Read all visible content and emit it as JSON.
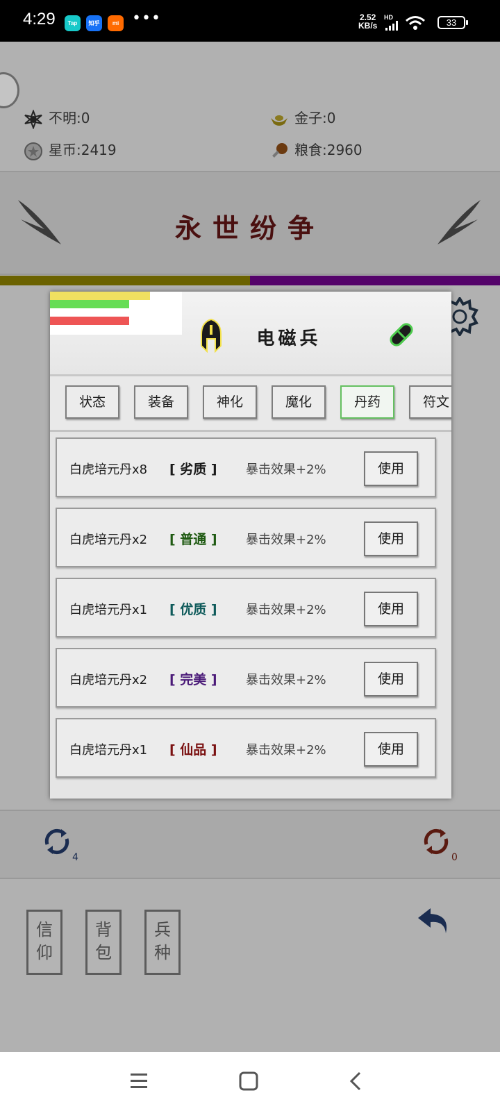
{
  "status_bar": {
    "time": "4:29",
    "apps": [
      {
        "name": "Tap",
        "color": "#18c9c9"
      },
      {
        "name": "知乎",
        "color": "#1772f6"
      },
      {
        "name": "mi",
        "color": "#ff6a00"
      }
    ],
    "more": "•••",
    "net_speed_value": "2.52",
    "net_speed_unit": "KB/s",
    "hd_label": "HD",
    "battery": "33"
  },
  "resources": {
    "unknown": "不明:0",
    "gold": "金子:0",
    "star_coins": "星币:2419",
    "food": "粮食:2960"
  },
  "game": {
    "title": "永世纷争",
    "player_bar_fraction": 0.5,
    "left_refresh_count": "4",
    "right_refresh_count": "0",
    "side_buttons": [
      {
        "top": "信",
        "bottom": "仰"
      },
      {
        "top": "背",
        "bottom": "包"
      },
      {
        "top": "兵",
        "bottom": "种"
      }
    ]
  },
  "dialog": {
    "unit_name": "电磁兵",
    "stat_bars": [
      {
        "color": "#f0e060",
        "fraction": 0.76
      },
      {
        "color": "#66dd55",
        "fraction": 0.6
      },
      {
        "color": "#ee5555",
        "fraction": 0.6
      }
    ],
    "tabs": [
      {
        "label": "状态",
        "active": false
      },
      {
        "label": "装备",
        "active": false
      },
      {
        "label": "神化",
        "active": false
      },
      {
        "label": "魔化",
        "active": false
      },
      {
        "label": "丹药",
        "active": true
      },
      {
        "label": "符文",
        "active": false
      }
    ],
    "items": [
      {
        "name": "白虎培元丹x8",
        "grade": "[ 劣质 ]",
        "grade_color": "#1a1a1a",
        "effect": "暴击效果+2%",
        "button": "使用"
      },
      {
        "name": "白虎培元丹x2",
        "grade": "[ 普通 ]",
        "grade_color": "#1f5a12",
        "effect": "暴击效果+2%",
        "button": "使用"
      },
      {
        "name": "白虎培元丹x1",
        "grade": "[ 优质 ]",
        "grade_color": "#0e5a5a",
        "effect": "暴击效果+2%",
        "button": "使用"
      },
      {
        "name": "白虎培元丹x2",
        "grade": "[ 完美 ]",
        "grade_color": "#4a1a78",
        "effect": "暴击效果+2%",
        "button": "使用"
      },
      {
        "name": "白虎培元丹x1",
        "grade": "[ 仙品 ]",
        "grade_color": "#7a1010",
        "effect": "暴击效果+2%",
        "button": "使用"
      }
    ]
  }
}
